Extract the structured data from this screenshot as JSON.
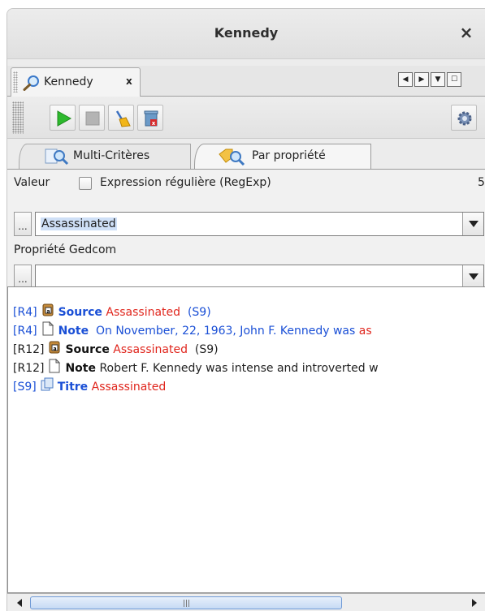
{
  "window": {
    "title": "Kennedy",
    "close_glyph": "×"
  },
  "dock_tab": {
    "label": "Kennedy",
    "close_glyph": "x",
    "icon": "search-icon"
  },
  "toolbar": {
    "buttons": [
      {
        "name": "run-button",
        "icon": "play-icon"
      },
      {
        "name": "stop-button",
        "icon": "stop-icon"
      },
      {
        "name": "clear-button",
        "icon": "broom-icon"
      },
      {
        "name": "delete-button",
        "icon": "trash-icon"
      },
      {
        "name": "settings-button",
        "icon": "gear-icon"
      }
    ]
  },
  "tabs": [
    {
      "label": "Multi-Critères",
      "icon": "multi-search-icon",
      "active": false
    },
    {
      "label": "Par propriété",
      "icon": "tag-search-icon",
      "active": true
    }
  ],
  "form": {
    "valeur_label": "Valeur",
    "regex_label": "Expression régulière (RegExp)",
    "regex_checked": false,
    "count": "5",
    "value_input": "Assassinated",
    "dots_label": "...",
    "property_label": "Propriété Gedcom",
    "property_input": ""
  },
  "results": [
    {
      "ref": "[R4]",
      "ref_color": "blue",
      "icon": "source-icon",
      "keyword": "Source",
      "keyword_color": "blue",
      "parts": [
        {
          "text": " Assassinated",
          "color": "red"
        },
        {
          "text": "  (S9)",
          "color": "blue"
        }
      ]
    },
    {
      "ref": "[R4]",
      "ref_color": "blue",
      "icon": "note-icon",
      "keyword": "Note",
      "keyword_color": "blue",
      "parts": [
        {
          "text": "  On November, 22, 1963, John F. Kennedy was ",
          "color": "blue"
        },
        {
          "text": "as",
          "color": "red"
        }
      ]
    },
    {
      "ref": "[R12]",
      "ref_color": "black",
      "icon": "source-icon",
      "keyword": "Source",
      "keyword_color": "black",
      "parts": [
        {
          "text": " Assassinated",
          "color": "red"
        },
        {
          "text": "  (S9)",
          "color": "black"
        }
      ]
    },
    {
      "ref": "[R12]",
      "ref_color": "black",
      "icon": "note-icon",
      "keyword": "Note",
      "keyword_color": "black",
      "parts": [
        {
          "text": " Robert F. Kennedy was intense and introverted w",
          "color": "black"
        }
      ]
    },
    {
      "ref": "[S9]",
      "ref_color": "blue",
      "icon": "title-icon",
      "keyword": "Titre",
      "keyword_color": "blue",
      "parts": [
        {
          "text": " Assassinated",
          "color": "red"
        }
      ]
    }
  ],
  "scrollbar": {
    "position": 0.0
  },
  "colors": {
    "link_blue": "#1a4fd6",
    "match_red": "#e0261d",
    "play_green": "#2db92d"
  }
}
